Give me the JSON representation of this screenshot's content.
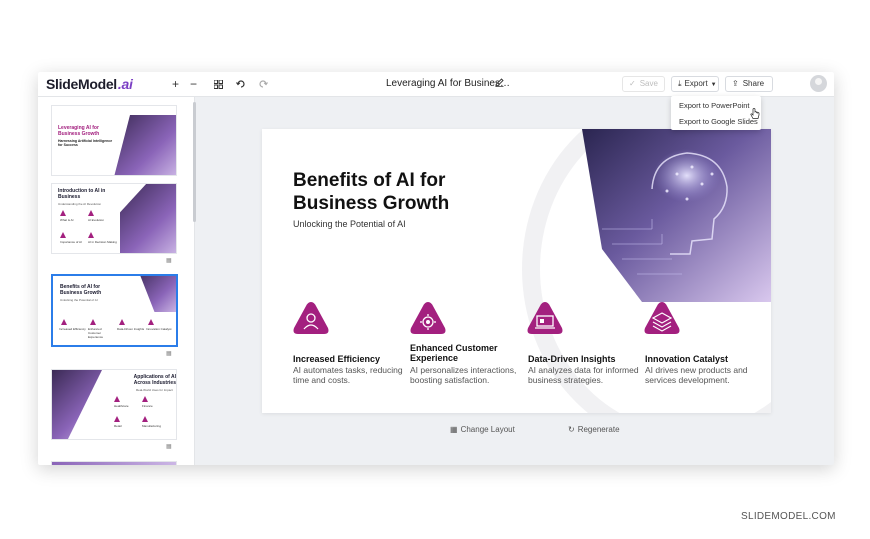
{
  "app": {
    "logo_text": "SlideModel",
    "logo_ai": ".ai",
    "doc_title": "Leveraging AI for Busines…",
    "toolbar": {
      "zoom_in": "+",
      "zoom_out": "−",
      "grid_icon": "grid-icon",
      "undo_icon": "undo-icon",
      "redo_icon": "redo-icon"
    },
    "save_label": "Save",
    "export_label": "Export",
    "share_label": "Share",
    "export_menu": [
      "Export to PowerPoint",
      "Export to Google Slides"
    ]
  },
  "sidebar": {
    "thumbnails": [
      {
        "title": "Leveraging AI for Business Growth",
        "subtitle": "Harnessing Artificial Intelligence for Success"
      },
      {
        "title": "Introduction to AI in Business",
        "subtitle": "Understanding the AI Revolution",
        "items": [
          "What is AI",
          "AI Evolution",
          "Importance of AI",
          "AI in Decision Making"
        ]
      },
      {
        "title": "Benefits of AI for Business Growth",
        "subtitle": "Unlocking the Potential of AI",
        "items": [
          "Increased Efficiency",
          "Enhanced Customer Experience",
          "Data-Driven Insights",
          "Innovation Catalyst"
        ]
      },
      {
        "title": "Applications of AI Across Industries",
        "subtitle": "Real-World Uses for Impact",
        "items": [
          "Healthcare",
          "Finance",
          "Retail",
          "Manufacturing"
        ]
      }
    ]
  },
  "slide": {
    "title": "Benefits of AI for Business Growth",
    "subtitle": "Unlocking the Potential of AI",
    "features": [
      {
        "title": "Increased Efficiency",
        "desc": "AI automates tasks, reducing time and costs.",
        "icon": "person-icon"
      },
      {
        "title": "Enhanced Customer Experience",
        "desc": "AI personalizes interactions, boosting satisfaction.",
        "icon": "gear-icon"
      },
      {
        "title": "Data-Driven Insights",
        "desc": "AI analyzes data for informed business strategies.",
        "icon": "devices-icon"
      },
      {
        "title": "Innovation Catalyst",
        "desc": "AI drives new products and services development.",
        "icon": "layers-icon"
      }
    ]
  },
  "actions": {
    "change_layout": "Change Layout",
    "regenerate": "Regenerate"
  },
  "watermark": "SLIDEMODEL.COM",
  "colors": {
    "accent": "#a3207f",
    "accent_dark": "#6e1a8a",
    "selection": "#2b7de9"
  }
}
